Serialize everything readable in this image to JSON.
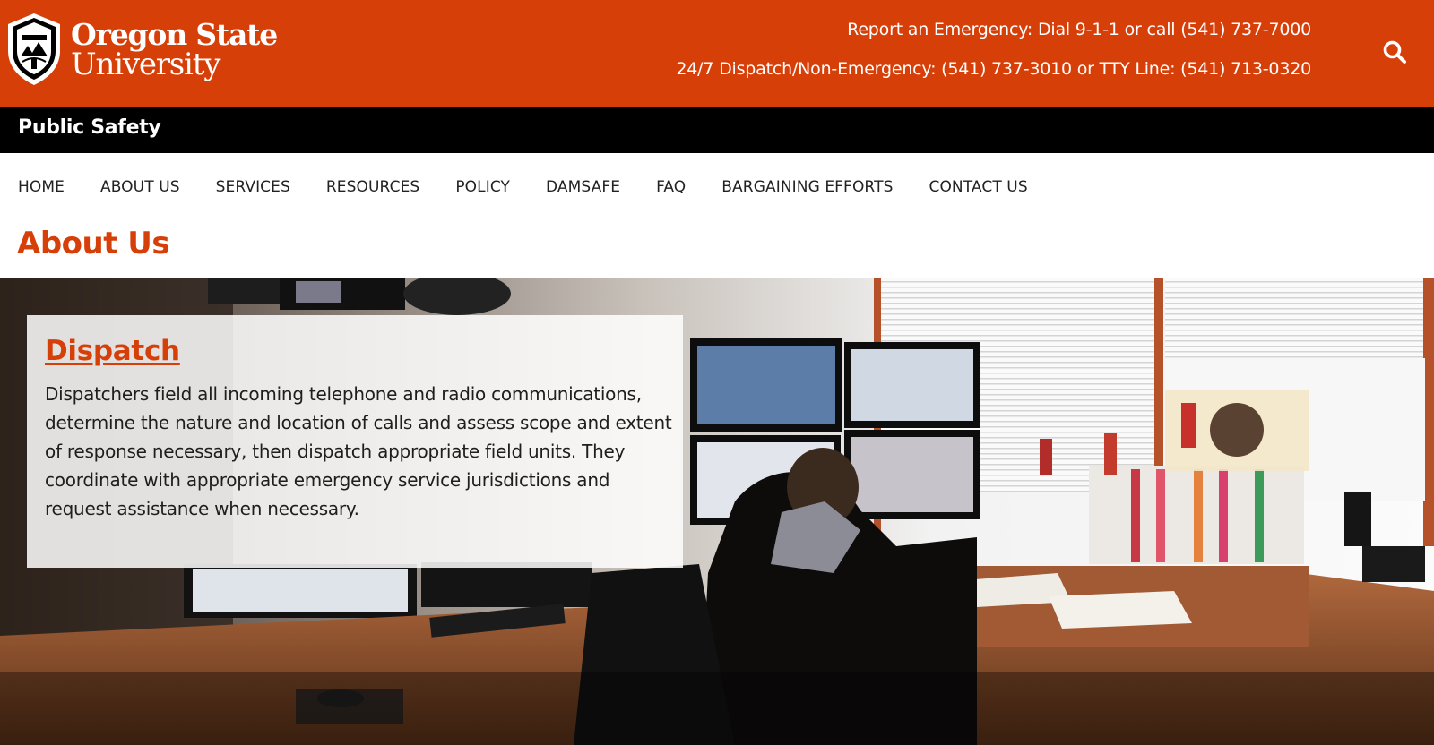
{
  "header": {
    "logo": {
      "line1": "Oregon State",
      "line2": "University",
      "icon": "osu-seal-icon"
    },
    "emergency_line": "Report an Emergency: Dial 9-1-1 or call (541) 737-7000",
    "dispatch_line": "24/7 Dispatch/Non-Emergency: (541) 737-3010 or TTY Line: (541) 713-0320",
    "search_icon": "search-icon",
    "brand_color": "#d73f09"
  },
  "site": {
    "title": "Public Safety"
  },
  "nav": {
    "items": [
      {
        "label": "HOME"
      },
      {
        "label": "ABOUT US"
      },
      {
        "label": "SERVICES"
      },
      {
        "label": "RESOURCES"
      },
      {
        "label": "POLICY"
      },
      {
        "label": "DAMSAFE"
      },
      {
        "label": "FAQ"
      },
      {
        "label": "BARGAINING EFFORTS"
      },
      {
        "label": "CONTACT US"
      }
    ]
  },
  "main": {
    "page_title": "About Us",
    "hero": {
      "image": "dispatch-center-photo",
      "card": {
        "title": "Dispatch",
        "body": "Dispatchers field all incoming telephone and radio communications, determine the nature and location of calls and assess scope and extent of response necessary, then dispatch appropriate field units. They coordinate with appropriate emergency service jurisdictions and request assistance when necessary."
      }
    }
  }
}
